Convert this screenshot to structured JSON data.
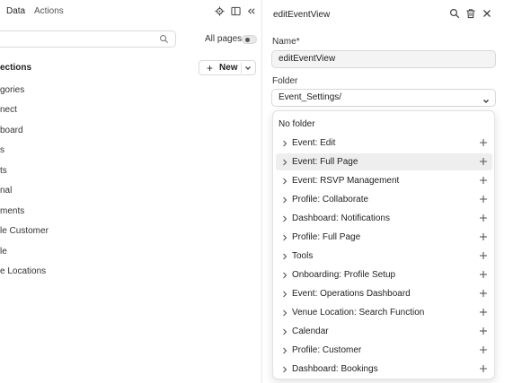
{
  "left_panel": {
    "tabs": [
      {
        "label": "Data",
        "active": true
      },
      {
        "label": "Actions",
        "active": false
      }
    ],
    "icons": [
      "settings-icon",
      "split-view-icon",
      "collapse-icon"
    ],
    "search": {
      "value": "",
      "placeholder": ""
    },
    "all_pages": {
      "label": "All pages",
      "checked": false
    },
    "section_title": "ections",
    "new_button": {
      "label": "New"
    },
    "tree_items": [
      "gories",
      "nect",
      "board",
      "s",
      "ts",
      "nal",
      "ments",
      "le Customer",
      "le",
      "e Locations"
    ]
  },
  "right_panel": {
    "title": "editEventView",
    "icons": [
      "search-icon",
      "trash-icon",
      "close-icon"
    ],
    "name_field": {
      "label": "Name",
      "required_mark": "*",
      "value": "editEventView"
    },
    "folder_field": {
      "label": "Folder",
      "value": "Event_Settings/"
    },
    "dropdown": {
      "no_folder": "No folder",
      "highlighted_index": 1,
      "items": [
        "Event: Edit",
        "Event: Full Page",
        "Event: RSVP Management",
        "Profile: Collaborate",
        "Dashboard: Notifications",
        "Profile: Full Page",
        "Tools",
        "Onboarding: Profile Setup",
        "Event: Operations Dashboard",
        "Venue Location: Search Function",
        "Calendar",
        "Profile: Customer",
        "Dashboard: Bookings"
      ]
    }
  }
}
